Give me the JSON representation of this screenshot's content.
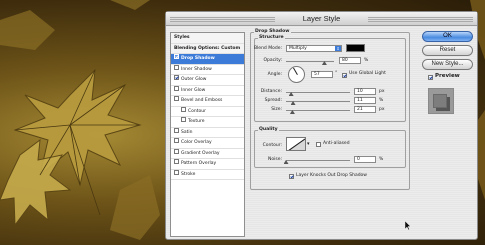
{
  "dialog": {
    "title": "Layer Style"
  },
  "styles_list": {
    "items": [
      {
        "label": "Styles",
        "header": true
      },
      {
        "label": "Blending Options: Custom",
        "header": true
      },
      {
        "label": "Drop Shadow",
        "checkbox": true,
        "checked": true,
        "selected": true
      },
      {
        "label": "Inner Shadow",
        "checkbox": true,
        "checked": false
      },
      {
        "label": "Outer Glow",
        "checkbox": true,
        "checked": true
      },
      {
        "label": "Inner Glow",
        "checkbox": true,
        "checked": false
      },
      {
        "label": "Bevel and Emboss",
        "checkbox": true,
        "checked": false
      },
      {
        "label": "Contour",
        "checkbox": true,
        "checked": false,
        "sub": true
      },
      {
        "label": "Texture",
        "checkbox": true,
        "checked": false,
        "sub": true
      },
      {
        "label": "Satin",
        "checkbox": true,
        "checked": false
      },
      {
        "label": "Color Overlay",
        "checkbox": true,
        "checked": false
      },
      {
        "label": "Gradient Overlay",
        "checkbox": true,
        "checked": false
      },
      {
        "label": "Pattern Overlay",
        "checkbox": true,
        "checked": false
      },
      {
        "label": "Stroke",
        "checkbox": true,
        "checked": false
      }
    ]
  },
  "drop_shadow": {
    "title": "Drop Shadow",
    "structure": {
      "title": "Structure",
      "blend_mode_label": "Blend Mode:",
      "blend_mode_value": "Multiply",
      "shadow_color": "#000000",
      "opacity_label": "Opacity:",
      "opacity_value": "80",
      "opacity_unit": "%",
      "opacity_fraction": 0.8,
      "angle_label": "Angle:",
      "angle_value": "57",
      "angle_unit": "°",
      "use_global_light_label": "Use Global Light",
      "use_global_light_checked": true,
      "distance_label": "Distance:",
      "distance_value": "10",
      "distance_unit": "px",
      "distance_fraction": 0.08,
      "spread_label": "Spread:",
      "spread_value": "11",
      "spread_unit": "%",
      "spread_fraction": 0.11,
      "size_label": "Size:",
      "size_value": "21",
      "size_unit": "px",
      "size_fraction": 0.1
    },
    "quality": {
      "title": "Quality",
      "contour_label": "Contour:",
      "anti_aliased_label": "Anti-aliased",
      "anti_aliased_checked": false,
      "noise_label": "Noise:",
      "noise_value": "0",
      "noise_unit": "%",
      "noise_fraction": 0.0
    },
    "layer_knocks_out_label": "Layer Knocks Out Drop Shadow",
    "layer_knocks_out_checked": true
  },
  "buttons": {
    "ok": "OK",
    "reset": "Reset",
    "new_style": "New Style...",
    "preview_label": "Preview",
    "preview_checked": true
  },
  "colors": {
    "accent": "#3d7bd9",
    "selection": "#3d7bd9"
  },
  "icons": {
    "cursor": "mouse-pointer-icon",
    "angle_dial": "angle-dial-icon",
    "contour": "contour-curve-icon"
  }
}
